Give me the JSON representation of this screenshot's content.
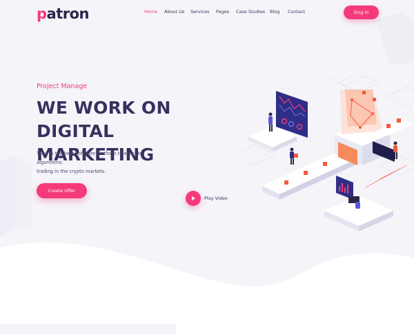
{
  "brand": {
    "logo_text_prefix": "p",
    "logo_text_rest": "atron"
  },
  "nav": {
    "items": [
      {
        "label": "Home",
        "active": true
      },
      {
        "label": "About Us",
        "active": false
      },
      {
        "label": "Services",
        "active": false
      },
      {
        "label": "Pages",
        "active": false
      },
      {
        "label": "Case Studies",
        "active": false
      },
      {
        "label": "Blog",
        "active": false
      },
      {
        "label": "Contact",
        "active": false
      }
    ],
    "signin_label": "Sing In"
  },
  "hero": {
    "eyebrow": "Project Manage",
    "headline_line1": "WE WORK ON DIGITAL",
    "headline_line2": "MARKETING",
    "subtitle_line1": "Tainy is the best software platform to execute algorithmic",
    "subtitle_line2": "trading in the crypto markets.",
    "cta_label": "Create Offer",
    "play_label": "Play Video"
  },
  "colors": {
    "accent": "#f43a79",
    "heading": "#3a2f5e",
    "background": "#f4f4f9"
  }
}
